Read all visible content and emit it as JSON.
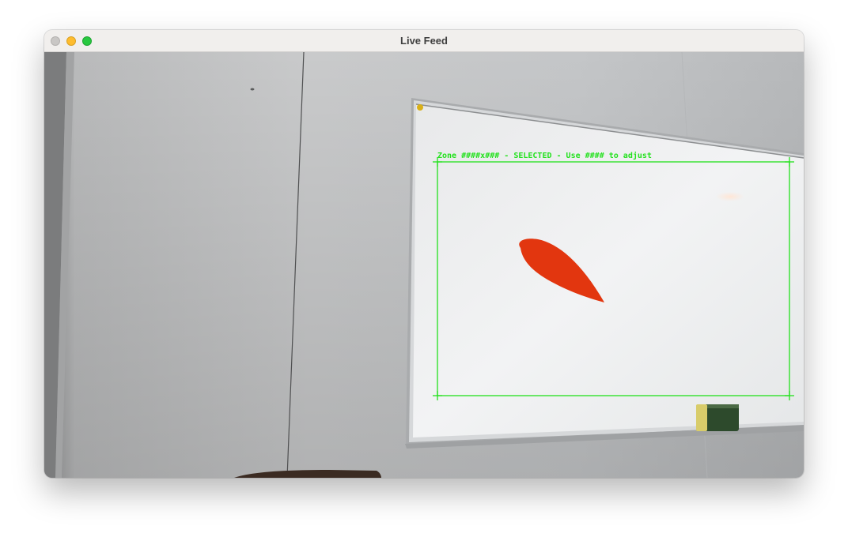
{
  "window": {
    "title": "Live Feed"
  },
  "overlay": {
    "label": "Zone ####x### - SELECTED - Use #### to adjust",
    "color": "#22e11c"
  },
  "scene": {
    "wall_color": "#c7c9cb",
    "board_color": "#f0f1f2",
    "shape_color": "#e2360f"
  }
}
